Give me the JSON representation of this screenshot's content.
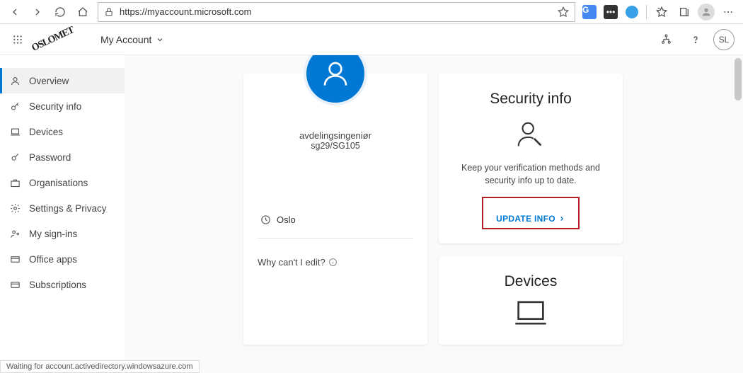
{
  "browser": {
    "url": "https://myaccount.microsoft.com"
  },
  "header": {
    "account_label": "My Account",
    "user_initials": "SL",
    "brand": "OSLOMET"
  },
  "sidebar": {
    "items": [
      {
        "label": "Overview"
      },
      {
        "label": "Security info"
      },
      {
        "label": "Devices"
      },
      {
        "label": "Password"
      },
      {
        "label": "Organisations"
      },
      {
        "label": "Settings & Privacy"
      },
      {
        "label": "My sign-ins"
      },
      {
        "label": "Office apps"
      },
      {
        "label": "Subscriptions"
      }
    ]
  },
  "profile": {
    "line1": "avdelingsingeniør",
    "line2": "sg29/SG105",
    "location": "Oslo",
    "edit_question": "Why can't I edit?"
  },
  "security": {
    "title": "Security info",
    "desc": "Keep your verification methods and security info up to date.",
    "cta": "UPDATE INFO"
  },
  "devices": {
    "title": "Devices"
  },
  "status": "Waiting for account.activedirectory.windowsazure.com"
}
